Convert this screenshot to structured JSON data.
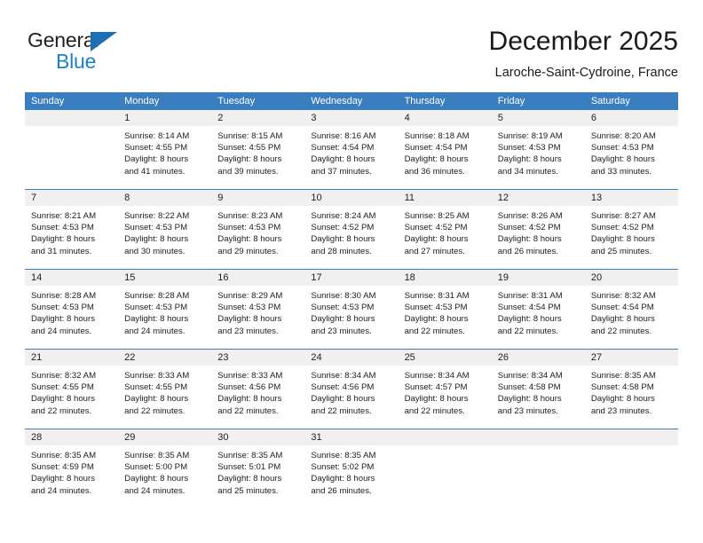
{
  "brand": {
    "word_general": "General",
    "word_blue": "Blue",
    "accent_color": "#1f7fc4",
    "triangle_color": "#1f6eb5"
  },
  "header": {
    "title": "December 2025",
    "subtitle": "Laroche-Saint-Cydroine, France"
  },
  "calendar": {
    "header_bg": "#3b7ebf",
    "day_number_bg": "#f0f0f0",
    "weekdays": [
      "Sunday",
      "Monday",
      "Tuesday",
      "Wednesday",
      "Thursday",
      "Friday",
      "Saturday"
    ],
    "weeks": [
      [
        {
          "day": "",
          "lines": []
        },
        {
          "day": "1",
          "lines": [
            "Sunrise: 8:14 AM",
            "Sunset: 4:55 PM",
            "Daylight: 8 hours",
            "and 41 minutes."
          ]
        },
        {
          "day": "2",
          "lines": [
            "Sunrise: 8:15 AM",
            "Sunset: 4:55 PM",
            "Daylight: 8 hours",
            "and 39 minutes."
          ]
        },
        {
          "day": "3",
          "lines": [
            "Sunrise: 8:16 AM",
            "Sunset: 4:54 PM",
            "Daylight: 8 hours",
            "and 37 minutes."
          ]
        },
        {
          "day": "4",
          "lines": [
            "Sunrise: 8:18 AM",
            "Sunset: 4:54 PM",
            "Daylight: 8 hours",
            "and 36 minutes."
          ]
        },
        {
          "day": "5",
          "lines": [
            "Sunrise: 8:19 AM",
            "Sunset: 4:53 PM",
            "Daylight: 8 hours",
            "and 34 minutes."
          ]
        },
        {
          "day": "6",
          "lines": [
            "Sunrise: 8:20 AM",
            "Sunset: 4:53 PM",
            "Daylight: 8 hours",
            "and 33 minutes."
          ]
        }
      ],
      [
        {
          "day": "7",
          "lines": [
            "Sunrise: 8:21 AM",
            "Sunset: 4:53 PM",
            "Daylight: 8 hours",
            "and 31 minutes."
          ]
        },
        {
          "day": "8",
          "lines": [
            "Sunrise: 8:22 AM",
            "Sunset: 4:53 PM",
            "Daylight: 8 hours",
            "and 30 minutes."
          ]
        },
        {
          "day": "9",
          "lines": [
            "Sunrise: 8:23 AM",
            "Sunset: 4:53 PM",
            "Daylight: 8 hours",
            "and 29 minutes."
          ]
        },
        {
          "day": "10",
          "lines": [
            "Sunrise: 8:24 AM",
            "Sunset: 4:52 PM",
            "Daylight: 8 hours",
            "and 28 minutes."
          ]
        },
        {
          "day": "11",
          "lines": [
            "Sunrise: 8:25 AM",
            "Sunset: 4:52 PM",
            "Daylight: 8 hours",
            "and 27 minutes."
          ]
        },
        {
          "day": "12",
          "lines": [
            "Sunrise: 8:26 AM",
            "Sunset: 4:52 PM",
            "Daylight: 8 hours",
            "and 26 minutes."
          ]
        },
        {
          "day": "13",
          "lines": [
            "Sunrise: 8:27 AM",
            "Sunset: 4:52 PM",
            "Daylight: 8 hours",
            "and 25 minutes."
          ]
        }
      ],
      [
        {
          "day": "14",
          "lines": [
            "Sunrise: 8:28 AM",
            "Sunset: 4:53 PM",
            "Daylight: 8 hours",
            "and 24 minutes."
          ]
        },
        {
          "day": "15",
          "lines": [
            "Sunrise: 8:28 AM",
            "Sunset: 4:53 PM",
            "Daylight: 8 hours",
            "and 24 minutes."
          ]
        },
        {
          "day": "16",
          "lines": [
            "Sunrise: 8:29 AM",
            "Sunset: 4:53 PM",
            "Daylight: 8 hours",
            "and 23 minutes."
          ]
        },
        {
          "day": "17",
          "lines": [
            "Sunrise: 8:30 AM",
            "Sunset: 4:53 PM",
            "Daylight: 8 hours",
            "and 23 minutes."
          ]
        },
        {
          "day": "18",
          "lines": [
            "Sunrise: 8:31 AM",
            "Sunset: 4:53 PM",
            "Daylight: 8 hours",
            "and 22 minutes."
          ]
        },
        {
          "day": "19",
          "lines": [
            "Sunrise: 8:31 AM",
            "Sunset: 4:54 PM",
            "Daylight: 8 hours",
            "and 22 minutes."
          ]
        },
        {
          "day": "20",
          "lines": [
            "Sunrise: 8:32 AM",
            "Sunset: 4:54 PM",
            "Daylight: 8 hours",
            "and 22 minutes."
          ]
        }
      ],
      [
        {
          "day": "21",
          "lines": [
            "Sunrise: 8:32 AM",
            "Sunset: 4:55 PM",
            "Daylight: 8 hours",
            "and 22 minutes."
          ]
        },
        {
          "day": "22",
          "lines": [
            "Sunrise: 8:33 AM",
            "Sunset: 4:55 PM",
            "Daylight: 8 hours",
            "and 22 minutes."
          ]
        },
        {
          "day": "23",
          "lines": [
            "Sunrise: 8:33 AM",
            "Sunset: 4:56 PM",
            "Daylight: 8 hours",
            "and 22 minutes."
          ]
        },
        {
          "day": "24",
          "lines": [
            "Sunrise: 8:34 AM",
            "Sunset: 4:56 PM",
            "Daylight: 8 hours",
            "and 22 minutes."
          ]
        },
        {
          "day": "25",
          "lines": [
            "Sunrise: 8:34 AM",
            "Sunset: 4:57 PM",
            "Daylight: 8 hours",
            "and 22 minutes."
          ]
        },
        {
          "day": "26",
          "lines": [
            "Sunrise: 8:34 AM",
            "Sunset: 4:58 PM",
            "Daylight: 8 hours",
            "and 23 minutes."
          ]
        },
        {
          "day": "27",
          "lines": [
            "Sunrise: 8:35 AM",
            "Sunset: 4:58 PM",
            "Daylight: 8 hours",
            "and 23 minutes."
          ]
        }
      ],
      [
        {
          "day": "28",
          "lines": [
            "Sunrise: 8:35 AM",
            "Sunset: 4:59 PM",
            "Daylight: 8 hours",
            "and 24 minutes."
          ]
        },
        {
          "day": "29",
          "lines": [
            "Sunrise: 8:35 AM",
            "Sunset: 5:00 PM",
            "Daylight: 8 hours",
            "and 24 minutes."
          ]
        },
        {
          "day": "30",
          "lines": [
            "Sunrise: 8:35 AM",
            "Sunset: 5:01 PM",
            "Daylight: 8 hours",
            "and 25 minutes."
          ]
        },
        {
          "day": "31",
          "lines": [
            "Sunrise: 8:35 AM",
            "Sunset: 5:02 PM",
            "Daylight: 8 hours",
            "and 26 minutes."
          ]
        },
        {
          "day": "",
          "lines": []
        },
        {
          "day": "",
          "lines": []
        },
        {
          "day": "",
          "lines": []
        }
      ]
    ]
  }
}
